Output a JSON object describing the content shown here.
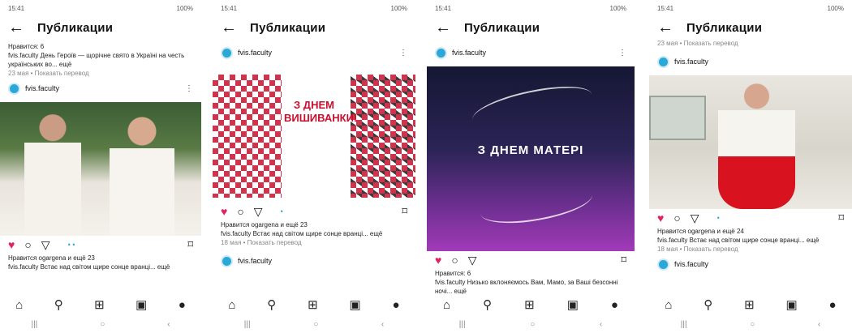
{
  "header_title": "Публикации",
  "status_time": "15:41",
  "status_battery": "100%",
  "account": "fvis.faculty",
  "phones": [
    {
      "top_likes": "Нравится: 6",
      "top_caption": "fvis.faculty День Героїв — щорічне свято в Україні на честь українських во... ещё",
      "top_meta": "23 мая • Показать перевод",
      "likes": "Нравится ogargena и ещё 23",
      "caption": "fvis.faculty Встає над світом щире сонце вранці... ещё"
    },
    {
      "banner": "З ДНЕМ ВИШИВАНКИ!",
      "likes": "Нравится ogargena и ещё 23",
      "caption": "fvis.faculty Встає над світом щире сонце вранці... ещё",
      "meta": "18 мая • Показать перевод"
    },
    {
      "banner": "З ДНЕМ МАТЕРІ",
      "likes": "Нравится: 6",
      "caption": "fvis.faculty Низько вклоняємось Вам, Мамо, за Ваші безсонні ночі... ещё"
    },
    {
      "top_meta": "23 мая • Показать перевод",
      "likes": "Нравится ogargena и ещё 24",
      "caption": "fvis.faculty Встає над світом щире сонце вранці... ещё",
      "meta": "18 мая • Показать перевод"
    }
  ],
  "nav_icons": [
    "home-icon",
    "search-icon",
    "create-icon",
    "reels-icon",
    "profile-icon"
  ],
  "sys_nav": [
    "|||",
    "○",
    "‹"
  ]
}
